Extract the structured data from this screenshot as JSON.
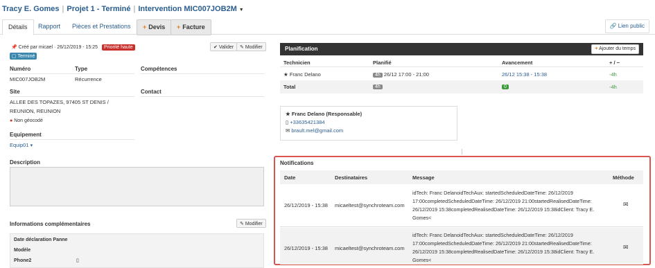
{
  "header": {
    "client": "Tracy E. Gomes",
    "project": "Projet 1 - Terminé",
    "intervention": "Intervention MIC007JOB2M"
  },
  "tabs": [
    {
      "label": "Détails"
    },
    {
      "label": "Rapport"
    },
    {
      "label": "Pièces et Prestations"
    },
    {
      "label": "Devis"
    },
    {
      "label": "Facture"
    }
  ],
  "lien_public": "Lien public",
  "left": {
    "created": "Créé par micael · 26/12/2019 - 15:25",
    "priority": "Priorité haute",
    "status": "Terminé",
    "valider": "Valider",
    "modifier": "Modifier",
    "numero_label": "Numéro",
    "numero": "MIC007JOB2M",
    "type_label": "Type",
    "type": "Récurrence",
    "competences_label": "Compétences",
    "site_label": "Site",
    "site_line1": "ALLEE DES TOPAZES, 97405 ST DENIS /",
    "site_line2": "REUNION, REUNION",
    "non_geocode": "Non géocodé",
    "contact_label": "Contact",
    "equipement_label": "Equipement",
    "equipement": "Equip01",
    "description_label": "Description",
    "info_label": "Informations complémentaires",
    "info_modifier": "Modifier",
    "date_panne": "Date déclaration Panne",
    "modele": "Modèle",
    "phone2": "Phone2"
  },
  "planning": {
    "title": "Planification",
    "ajouter": "Ajouter du temps",
    "cols": [
      "Technicien",
      "Planifié",
      "Avancement",
      "+ / −"
    ],
    "row": {
      "tech": "Franc Delano",
      "dur": "4h",
      "planned": "26/12 17:00 - 21:00",
      "progress": "26/12 15:38 - 15:38",
      "delta": "-4h"
    },
    "total": {
      "label": "Total",
      "dur": "4h",
      "count": "0",
      "delta": "-4h"
    }
  },
  "tech_card": {
    "name": "Franc Delano (Responsable)",
    "phone": "+33635421384",
    "email": "brault.mel@gmail.com"
  },
  "notifications": {
    "title": "Notifications",
    "cols": [
      "Date",
      "Destinataires",
      "Message",
      "Méthode"
    ],
    "rows": [
      {
        "date": "26/12/2019 - 15:38",
        "dest": "micaeltest@synchroteam.com",
        "m1": "idTech: Franc DelanoidTechAux: startedScheduledDateTime: 26/12/2019",
        "m2": "17:00completedScheduledDateTime: 26/12/2019 21:00startedRealisedDateTime:",
        "m3": "26/12/2019 15:38completedRealisedDateTime: 26/12/2019 15:38idClient: Tracy E.",
        "m4": "Gomes<"
      },
      {
        "date": "26/12/2019 - 15:38",
        "dest": "micaeltest@synchroteam.com",
        "m1": "idTech: Franc DelanoidTechAux: startedScheduledDateTime: 26/12/2019",
        "m2": "17:00completedScheduledDateTime: 26/12/2019 21:00startedRealisedDateTime:",
        "m3": "26/12/2019 15:38completedRealisedDateTime: 26/12/2019 15:38idClient: Tracy E.",
        "m4": "Gomes<"
      }
    ]
  }
}
